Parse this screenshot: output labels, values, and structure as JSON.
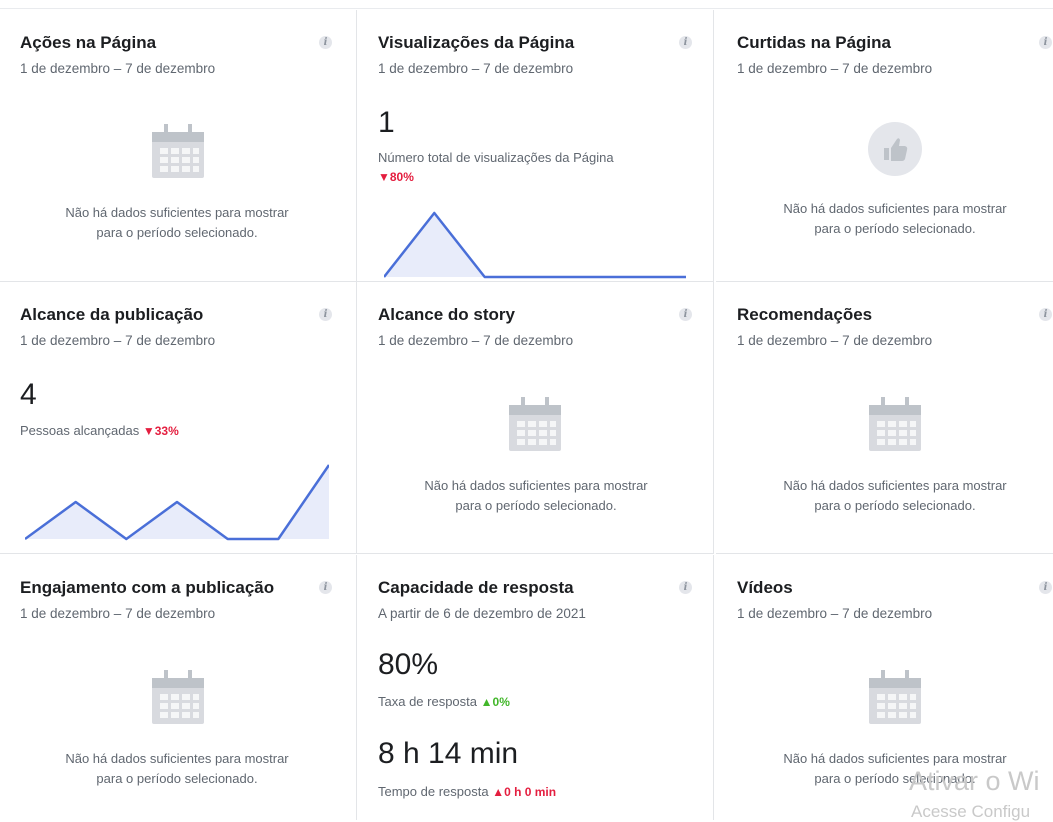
{
  "cards": [
    {
      "title": "Ações na Página",
      "subtitle": "1 de dezembro – 7 de dezembro",
      "empty": "Não há dados suficientes para mostrar\npara o período selecionado."
    },
    {
      "title": "Visualizações da Página",
      "subtitle": "1 de dezembro – 7 de dezembro",
      "value": "1",
      "metric_label": "Número total de visualizações da Página",
      "change": "▼80%",
      "chart": {
        "type": "area",
        "values": [
          0,
          1,
          0,
          0,
          0,
          0,
          0
        ]
      }
    },
    {
      "title": "Curtidas na Página",
      "subtitle": "1 de dezembro – 7 de dezembro",
      "empty": "Não há dados suficientes para mostrar\npara o período selecionado."
    },
    {
      "title": "Alcance da publicação",
      "subtitle": "1 de dezembro – 7 de dezembro",
      "value": "4",
      "metric_label": "Pessoas alcançadas",
      "change": "▼33%",
      "chart": {
        "type": "area",
        "values": [
          0,
          1,
          0,
          1,
          0,
          0,
          2
        ]
      }
    },
    {
      "title": "Alcance do story",
      "subtitle": "1 de dezembro – 7 de dezembro",
      "empty": "Não há dados suficientes para mostrar\npara o período selecionado."
    },
    {
      "title": "Recomendações",
      "subtitle": "1 de dezembro – 7 de dezembro",
      "empty": "Não há dados suficientes para mostrar\npara o período selecionado."
    },
    {
      "title": "Engajamento com a publicação",
      "subtitle": "1 de dezembro – 7 de dezembro",
      "empty": "Não há dados suficientes para mostrar\npara o período selecionado."
    },
    {
      "title": "Capacidade de resposta",
      "subtitle": "A partir de 6 de dezembro de 2021",
      "value": "80%",
      "metric_label": "Taxa de resposta",
      "change": "▲0%",
      "value2": "8 h 14 min",
      "metric_label2": "Tempo de resposta",
      "change2": "▲0 h 0 min"
    },
    {
      "title": "Vídeos",
      "subtitle": "1 de dezembro – 7 de dezembro",
      "empty": "Não há dados suficientes para mostrar\npara o período selecionado."
    }
  ],
  "info_icon": "i",
  "watermark": {
    "line1": "Ativar o Wi",
    "line2": "Acesse Configu"
  },
  "colors": {
    "line": "#4a6fd8",
    "fill": "#e8ecfa",
    "down": "#e41e3f",
    "up": "#42b72a"
  }
}
